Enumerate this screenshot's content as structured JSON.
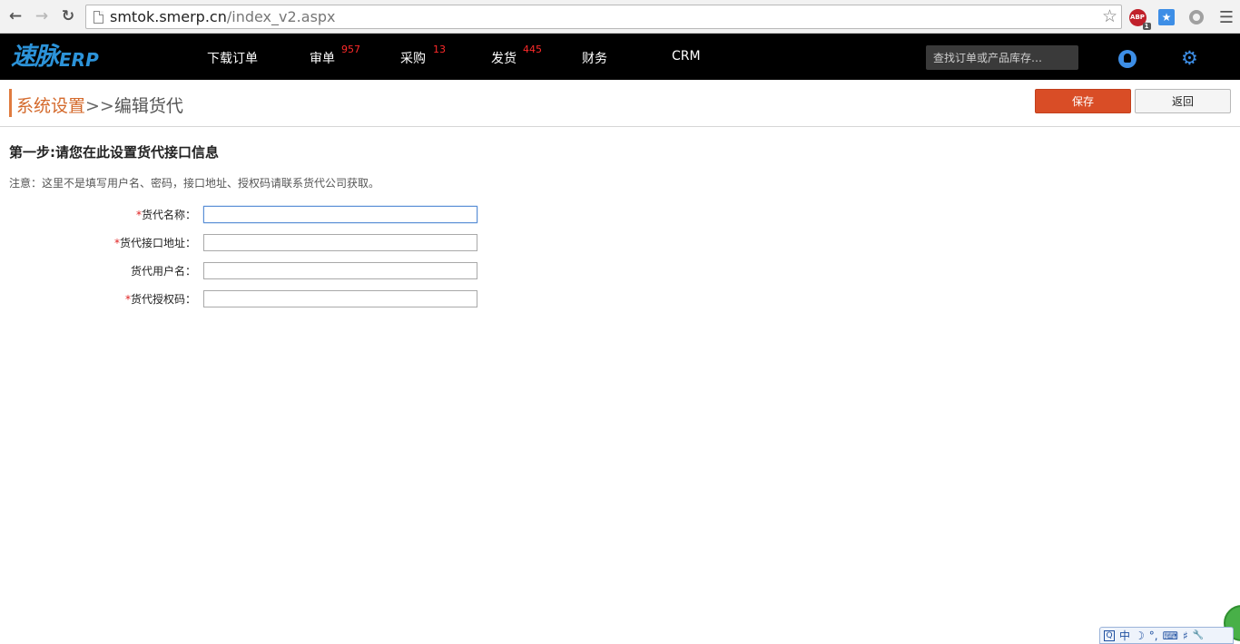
{
  "browser": {
    "url_host": "smtok.smerp.cn",
    "url_path": "/index_v2.aspx",
    "abp_label": "ABP",
    "abp_count": "1"
  },
  "header": {
    "logo_cn": "速脉",
    "logo_en": "ERP",
    "nav": [
      {
        "label": "下载订单",
        "badge": ""
      },
      {
        "label": "审单",
        "badge": "957"
      },
      {
        "label": "采购",
        "badge": "13"
      },
      {
        "label": "发货",
        "badge": "445"
      },
      {
        "label": "财务",
        "badge": ""
      },
      {
        "label": "CRM",
        "badge": ""
      }
    ],
    "search_placeholder": "查找订单或产品库存…",
    "accent_color": "#2c93d9"
  },
  "title_row": {
    "crumb_parent": "系统设置",
    "crumb_sep": ">>",
    "crumb_current": "编辑货代",
    "save_label": "保存",
    "back_label": "返回",
    "save_color": "#d94d26"
  },
  "content": {
    "step_title": "第一步:请您在此设置货代接口信息",
    "note": "注意：这里不是填写用户名、密码，接口地址、授权码请联系货代公司获取。",
    "fields": [
      {
        "label": "货代名称：",
        "required": true,
        "value": ""
      },
      {
        "label": "货代接口地址：",
        "required": true,
        "value": ""
      },
      {
        "label": "货代用户名：",
        "required": false,
        "value": ""
      },
      {
        "label": "货代授权码：",
        "required": true,
        "value": ""
      }
    ],
    "required_mark": "*"
  },
  "ime": {
    "items": [
      "中",
      "☽",
      "°,",
      "⌨",
      "♯",
      "🔧"
    ]
  }
}
